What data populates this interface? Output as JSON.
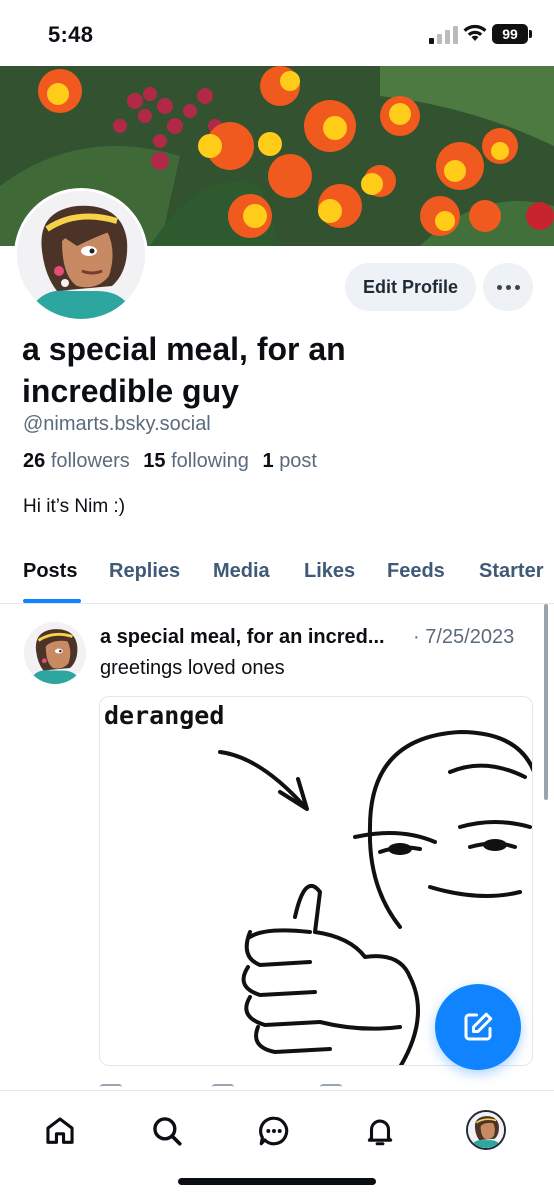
{
  "status_bar": {
    "time": "5:48",
    "battery": "99",
    "icons": [
      "cellular-signal-icon",
      "wifi-icon",
      "battery-icon"
    ]
  },
  "profile": {
    "display_name": "a special meal, for an incredible guy",
    "handle": "@nimarts.bsky.social",
    "followers_count": "26",
    "followers_label": "followers",
    "following_count": "15",
    "following_label": "following",
    "posts_count": "1",
    "posts_label": "post",
    "bio": "Hi it’s Nim :)",
    "edit_profile_label": "Edit Profile"
  },
  "tabs": [
    {
      "label": "Posts",
      "active": true
    },
    {
      "label": "Replies",
      "active": false
    },
    {
      "label": "Media",
      "active": false
    },
    {
      "label": "Likes",
      "active": false
    },
    {
      "label": "Feeds",
      "active": false
    },
    {
      "label": "Starter",
      "active": false
    }
  ],
  "post": {
    "author": "a special meal, for an incred...",
    "date": "· 7/25/2023",
    "text": "greetings loved ones",
    "image_caption": "deranged"
  },
  "bottom_nav": [
    "home-icon",
    "search-icon",
    "chat-icon",
    "notifications-icon",
    "profile-avatar"
  ],
  "colors": {
    "accent": "#1083fe",
    "muted_text": "#5b6b7c",
    "tab_text": "#3f5a76",
    "button_bg": "#eef1f5"
  }
}
